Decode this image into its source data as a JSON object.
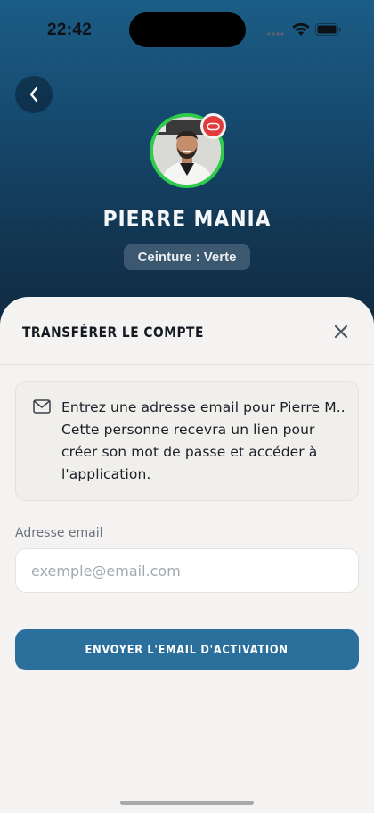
{
  "status_bar": {
    "time": "22:42"
  },
  "header": {
    "back_icon": "chevron-left-icon"
  },
  "profile": {
    "name": "PIERRE MANIA",
    "belt": "Ceinture : Verte",
    "ring_color": "#2ecc4a",
    "badge_color": "#e23b3b"
  },
  "sheet": {
    "title": "TRANSFÉRER LE COMPTE",
    "close_icon": "close-icon",
    "info_icon": "mail-icon",
    "info_text": "Entrez une adresse email pour Pierre M.. Cette personne recevra un lien pour créer son mot de passe et accéder à l'application.",
    "email_label": "Adresse email",
    "email_placeholder": "exemple@email.com",
    "email_value": "",
    "submit_label": "ENVOYER L'EMAIL D'ACTIVATION",
    "accent_color": "#2b6f9c"
  }
}
